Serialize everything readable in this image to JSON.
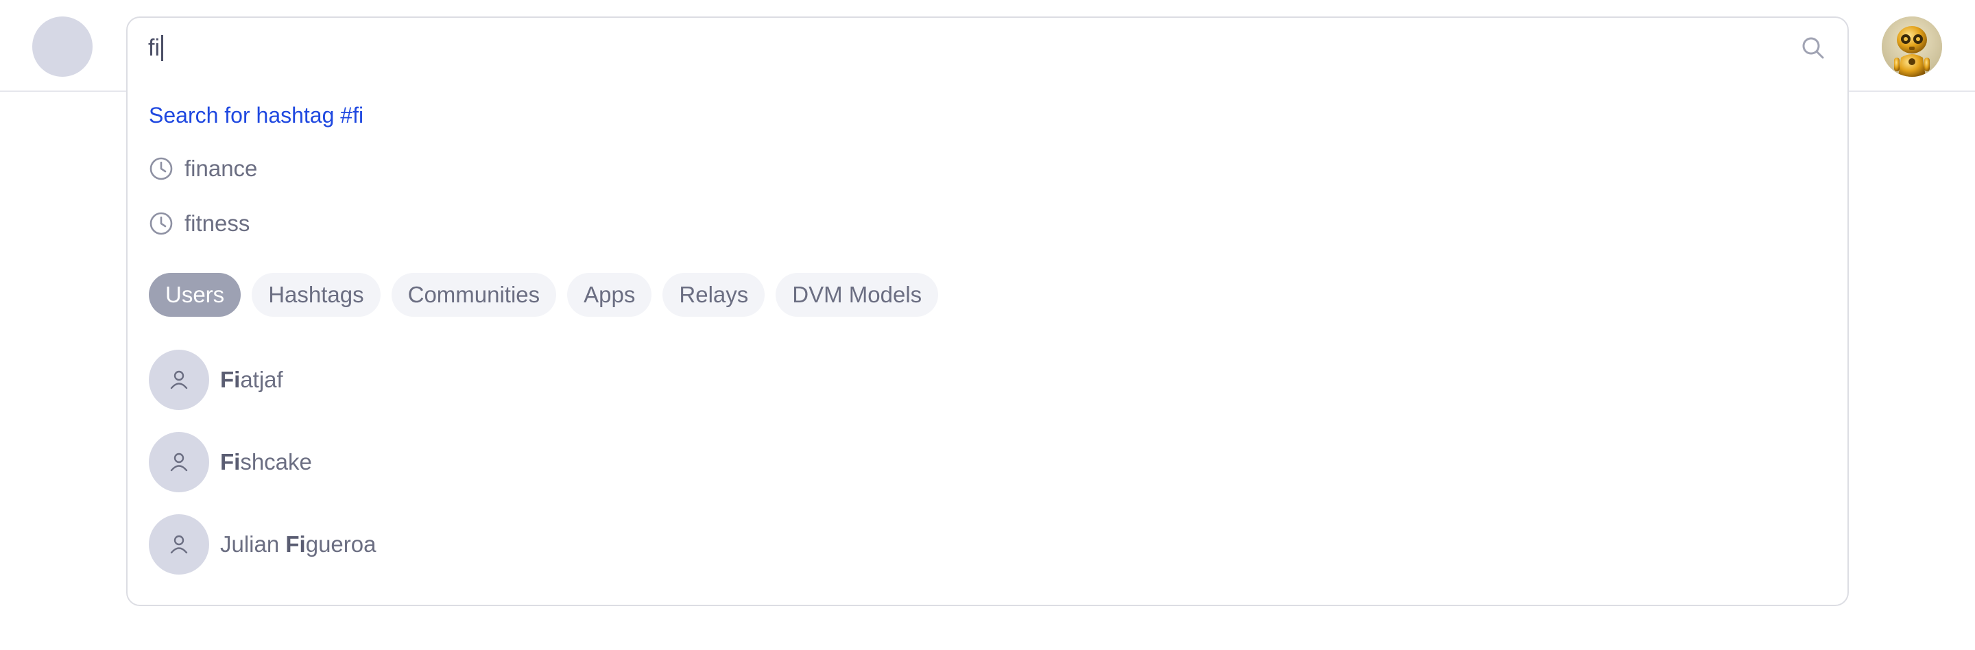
{
  "search": {
    "value": "fi"
  },
  "hashtag_suggestion": "Search for hashtag #fi",
  "recent_searches": [
    "finance",
    "fitness"
  ],
  "filters": [
    {
      "label": "Users",
      "active": true
    },
    {
      "label": "Hashtags",
      "active": false
    },
    {
      "label": "Communities",
      "active": false
    },
    {
      "label": "Apps",
      "active": false
    },
    {
      "label": "Relays",
      "active": false
    },
    {
      "label": "DVM Models",
      "active": false
    }
  ],
  "users": [
    {
      "prefix": "",
      "match": "Fi",
      "suffix": "atjaf"
    },
    {
      "prefix": "",
      "match": "Fi",
      "suffix": "shcake"
    },
    {
      "prefix": "Julian ",
      "match": "Fi",
      "suffix": "gueroa"
    }
  ],
  "icons": {
    "search": "search-icon",
    "recent": "clock-icon",
    "user_placeholder": "user-icon",
    "profile": "robot-avatar"
  },
  "colors": {
    "link": "#1f48e0",
    "chip_active": "#9da1b3",
    "chip_inactive": "#f3f4f8",
    "avatar_placeholder": "#d6d8e5"
  }
}
